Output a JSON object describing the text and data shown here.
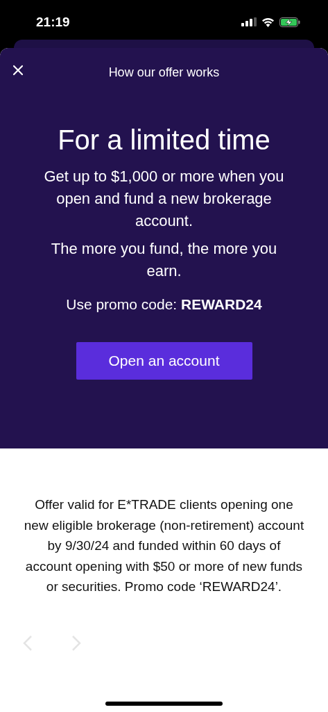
{
  "status_bar": {
    "time": "21:19"
  },
  "header": {
    "title": "How our offer works"
  },
  "hero": {
    "heading": "For a limited time",
    "paragraphs": [
      "Get up to $1,000 or more when you open and fund a new brokerage account.",
      "The more you fund, the more you earn."
    ],
    "promo": "Use promo code: **REWARD24**",
    "button": "Open an account"
  },
  "disclaimer": "Offer valid for E*TRADE clients opening one new eligible brokerage (non-retirement) account by 9/30/24 and funded within 60 days of account opening with $50 or more of new funds or securities. Promo code ‘REWARD24’.",
  "pager": [
    {
      "kind": "previous",
      "disabled": true
    },
    {
      "kind": "next",
      "disabled": true
    }
  ]
}
